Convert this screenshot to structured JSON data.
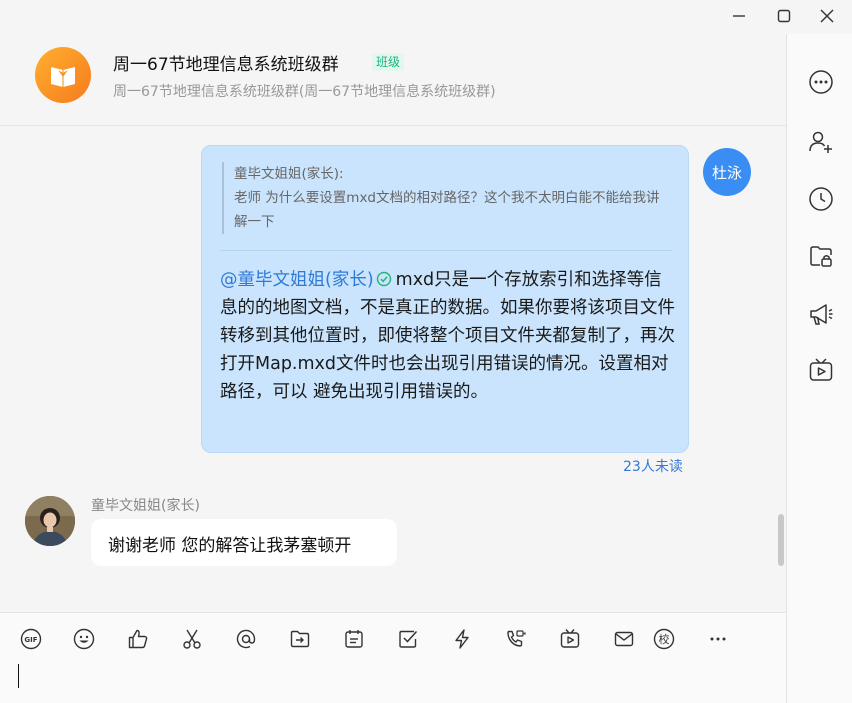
{
  "window": {
    "minimize": "—",
    "maximize": "☐",
    "close": "✕"
  },
  "header": {
    "title": "周一67节地理信息系统班级群",
    "badge": "班级",
    "subtitle": "周一67节地理信息系统班级群(周一67节地理信息系统班级群)"
  },
  "messages": {
    "me": {
      "avatar_text": "杜泳",
      "quote_author": "童毕文姐姐(家长):",
      "quote_text": "老师 为什么要设置mxd文档的相对路径？这个我不太明白能不能给我讲解一下",
      "mention": "@童毕文姐姐(家长)",
      "reply_text": "mxd只是一个存放索引和选择等信息的的地图文档，不是真正的数据。如果你要将该项目文件转移到其他位置时，即使将整个项目文件夹都复制了，再次打开Map.mxd文件时也会出现引用错误的情况。设置相对路径，可以 避免出现引用错误的。",
      "unread": "23人未读"
    },
    "other": {
      "name": "童毕文姐姐(家长)",
      "text": "谢谢老师 您的解答让我茅塞顿开"
    }
  },
  "toolbar": {
    "gif_label": "GIF",
    "school_label": "校",
    "more_label": "···"
  },
  "colors": {
    "accent": "#3a8ef3",
    "bubble_me": "#c9e4fc",
    "unread": "#3478d6",
    "badge_text": "#1fb47e"
  }
}
